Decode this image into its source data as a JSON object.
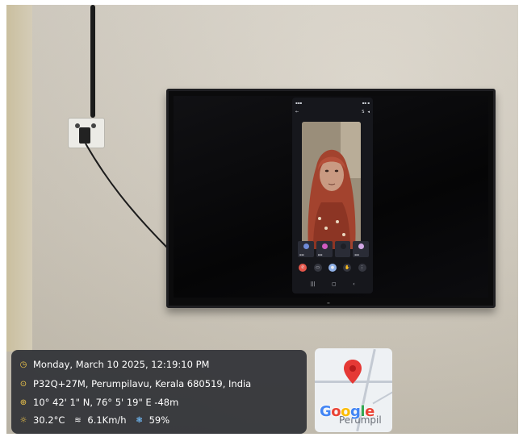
{
  "scene": {
    "description_icons": {
      "time": "clock-icon",
      "address": "location-pin-icon",
      "coords": "globe-icon",
      "weather": "sun-icon",
      "wind": "wind-icon",
      "humidity": "humidity-icon"
    },
    "colors": {
      "overlay_bg": "#282a30",
      "icon_accent": "#f2c84b",
      "map_pin": "#e53935"
    }
  },
  "overlay": {
    "datetime": "Monday, March 10 2025, 12:19:10 PM",
    "address": "P32Q+27M, Perumpilavu, Kerala 680519, India",
    "coordinates": "10° 42' 1\" N, 76° 5' 19\" E  -48m",
    "temperature": "30.2°C",
    "wind": "6.1Km/h",
    "humidity": "59%"
  },
  "map": {
    "logo": "Google",
    "place_fragment": "Perumpil"
  }
}
